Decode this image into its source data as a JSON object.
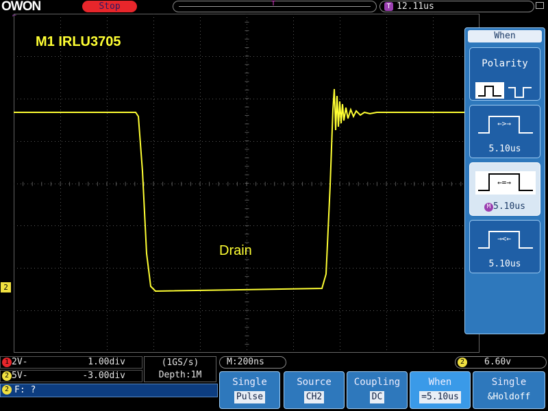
{
  "top": {
    "logo": "OWON",
    "status": "Stop",
    "time_badge": "T",
    "trigger_marker": "T",
    "timebase_position": "12.11us"
  },
  "screen": {
    "title": "M1  IRLU3705",
    "wave_label": "Drain",
    "ch2_marker": "2",
    "trace_color": "#ffff33",
    "grid_color": "#5a5a5a"
  },
  "menu": {
    "title": "When",
    "polarity_label": "Polarity",
    "items": [
      {
        "value": "5.10us"
      },
      {
        "value": "5.10us",
        "badge": "M"
      },
      {
        "value": "5.10us"
      }
    ]
  },
  "channels": [
    {
      "badge": "1",
      "volts": "2V-",
      "offset": "1.00div",
      "color": "#e8262b"
    },
    {
      "badge": "2",
      "volts": "5V-",
      "offset": "-3.00div",
      "color": "#f0e040"
    }
  ],
  "sample": {
    "rate": "(1GS/s)",
    "depth": "Depth:1M"
  },
  "freq": {
    "badge": "2",
    "label": "F:  ?"
  },
  "timebase": "M:200ns",
  "trigger": {
    "badge": "2",
    "level": "6.60v"
  },
  "buttons": [
    {
      "l1": "Single",
      "l2": "Pulse"
    },
    {
      "l1": "Source",
      "l2": "CH2"
    },
    {
      "l1": "Coupling",
      "l2": "DC"
    },
    {
      "l1": "When",
      "l2": "=5.10us"
    },
    {
      "l1": "Single",
      "l2": "&Holdoff"
    }
  ]
}
